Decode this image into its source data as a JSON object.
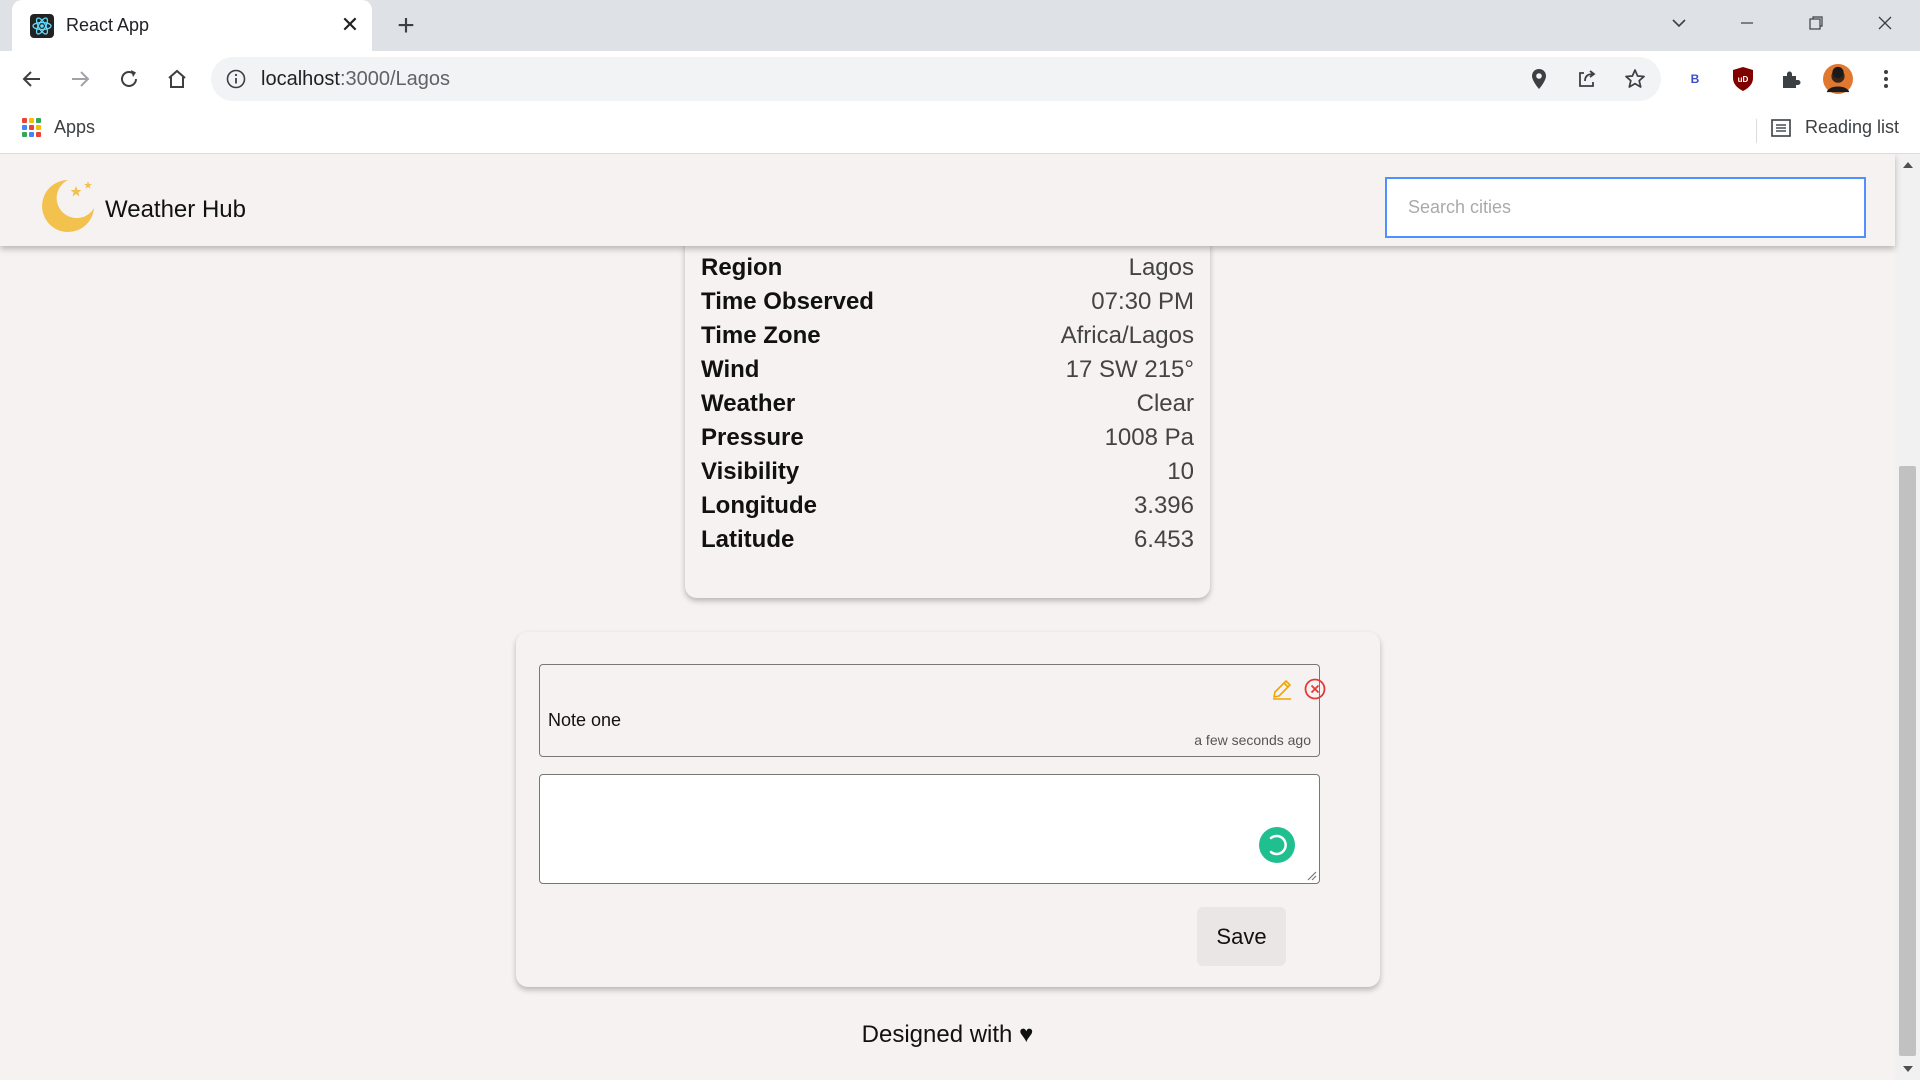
{
  "browser": {
    "tab_title": "React App",
    "url_host": "localhost",
    "url_path": ":3000/Lagos",
    "bookmark_apps": "Apps",
    "reading_list": "Reading list",
    "extension_b_label": "B",
    "extension_ub_label": "uD"
  },
  "header": {
    "brand": "Weather Hub",
    "search_placeholder": "Search cities"
  },
  "details": [
    {
      "label": "Region",
      "value": "Lagos"
    },
    {
      "label": "Time Observed",
      "value": "07:30 PM"
    },
    {
      "label": "Time Zone",
      "value": "Africa/Lagos"
    },
    {
      "label": "Wind",
      "value": "17 SW 215°"
    },
    {
      "label": "Weather",
      "value": "Clear"
    },
    {
      "label": "Pressure",
      "value": "1008 Pa"
    },
    {
      "label": "Visibility",
      "value": "10"
    },
    {
      "label": "Longitude",
      "value": "3.396"
    },
    {
      "label": "Latitude",
      "value": "6.453"
    }
  ],
  "notes": {
    "items": [
      {
        "text": "Note one",
        "time": "a few seconds ago"
      }
    ],
    "new_note_value": "",
    "save_label": "Save"
  },
  "footer": {
    "text": "Designed with ♥"
  },
  "icons": {
    "logo": "moon-stars-icon",
    "edit": "pencil-icon",
    "delete": "close-circle-icon",
    "submit_spinner": "loading-spinner-icon"
  },
  "colors": {
    "accent_logo": "#f2c14e",
    "edit_icon": "#f0a500",
    "delete_icon": "#e53935",
    "spinner": "#1fbf8f",
    "search_focus": "#4d90fe"
  }
}
